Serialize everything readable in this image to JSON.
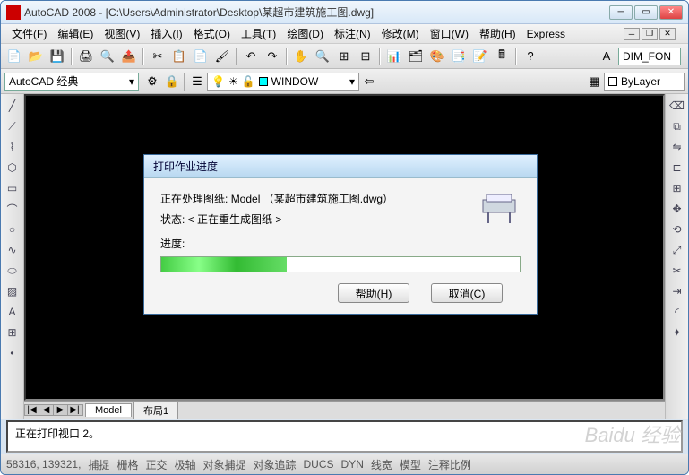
{
  "title": "AutoCAD 2008 - [C:\\Users\\Administrator\\Desktop\\某超市建筑施工图.dwg]",
  "menu": [
    "文件(F)",
    "编辑(E)",
    "视图(V)",
    "插入(I)",
    "格式(O)",
    "工具(T)",
    "绘图(D)",
    "标注(N)",
    "修改(M)",
    "窗口(W)",
    "帮助(H)",
    "Express"
  ],
  "workspace_combo": "AutoCAD 经典",
  "layer_combo_items": [
    "WINDOW"
  ],
  "prop_combo": "ByLayer",
  "dim_box": "DIM_FON",
  "tabs": {
    "nav": [
      "|◀",
      "◀",
      "▶",
      "▶|"
    ],
    "model": "Model",
    "layout": "布局1"
  },
  "cmd_text": "正在打印视口 2。",
  "status_coords": "58316, 139321, ",
  "status_items": [
    "捕捉",
    "栅格",
    "正交",
    "极轴",
    "对象捕捉",
    "对象追踪",
    "DUCS",
    "DYN",
    "线宽",
    "模型",
    "注释比例"
  ],
  "dialog": {
    "title": "打印作业进度",
    "processing_label": "正在处理图纸:",
    "processing_value": "Model （某超市建筑施工图.dwg）",
    "status_label": "状态:",
    "status_value": "< 正在重生成图纸 >",
    "progress_label": "进度:",
    "help_btn": "帮助(H)",
    "cancel_btn": "取消(C)"
  },
  "watermark": "Baidu 经验"
}
